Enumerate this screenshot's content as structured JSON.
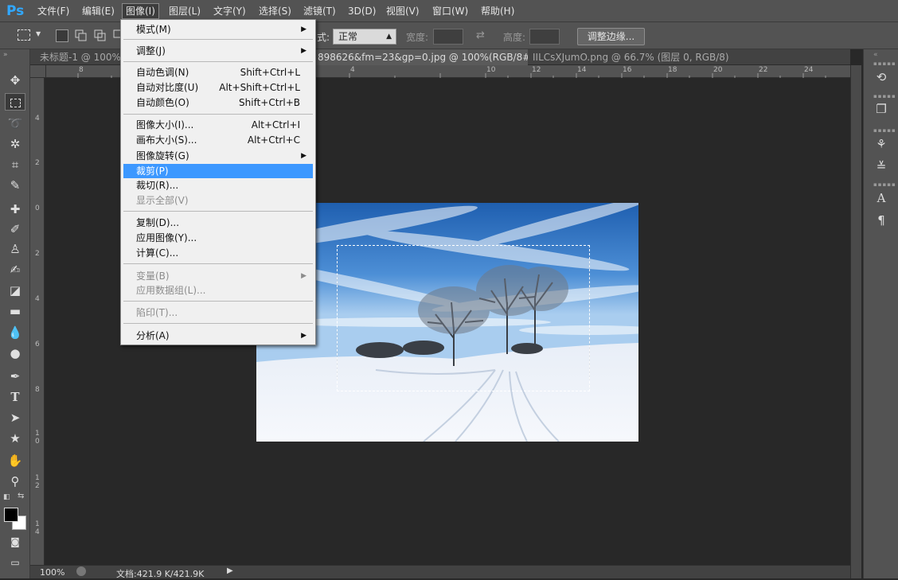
{
  "app": {
    "logo": "Ps"
  },
  "menubar": {
    "items": [
      "文件(F)",
      "编辑(E)",
      "图像(I)",
      "图层(L)",
      "文字(Y)",
      "选择(S)",
      "滤镜(T)",
      "3D(D)",
      "视图(V)",
      "窗口(W)",
      "帮助(H)"
    ],
    "open_index": 2
  },
  "options_bar": {
    "style_label": "式:",
    "style_value": "正常",
    "width_label": "宽度:",
    "height_label": "高度:",
    "refine_edge_button": "调整边缘..."
  },
  "tabs": [
    {
      "label": "未标题-1 @ 100%",
      "active": false
    },
    {
      "label": "898626&fm=23&gp=0.jpg @ 100%(RGB/8#)",
      "active": true
    },
    {
      "label": "IILCsXJumO.png @ 66.7% (图层 0, RGB/8)",
      "active": false
    }
  ],
  "tab_close_glyph": "×",
  "ruler_h": [
    "8",
    "4",
    "10",
    "12",
    "14",
    "16",
    "18",
    "20",
    "22",
    "24"
  ],
  "ruler_v": [
    "4",
    "2",
    "0",
    "2",
    "4",
    "6",
    "8",
    "1 0",
    "1 2",
    "1 4"
  ],
  "status": {
    "zoom": "100%",
    "doc_size": "文档:421.9 K/421.9K"
  },
  "image_menu": {
    "items": [
      {
        "label": "模式(M)",
        "shortcut": "",
        "submenu": true,
        "disabled": false,
        "highlight": false
      },
      {
        "label": "调整(J)",
        "shortcut": "",
        "submenu": true,
        "disabled": false,
        "highlight": false
      },
      {
        "label": "自动色调(N)",
        "shortcut": "Shift+Ctrl+L",
        "submenu": false,
        "disabled": false,
        "highlight": false
      },
      {
        "label": "自动对比度(U)",
        "shortcut": "Alt+Shift+Ctrl+L",
        "submenu": false,
        "disabled": false,
        "highlight": false
      },
      {
        "label": "自动颜色(O)",
        "shortcut": "Shift+Ctrl+B",
        "submenu": false,
        "disabled": false,
        "highlight": false
      },
      {
        "label": "图像大小(I)...",
        "shortcut": "Alt+Ctrl+I",
        "submenu": false,
        "disabled": false,
        "highlight": false
      },
      {
        "label": "画布大小(S)...",
        "shortcut": "Alt+Ctrl+C",
        "submenu": false,
        "disabled": false,
        "highlight": false
      },
      {
        "label": "图像旋转(G)",
        "shortcut": "",
        "submenu": true,
        "disabled": false,
        "highlight": false
      },
      {
        "label": "裁剪(P)",
        "shortcut": "",
        "submenu": false,
        "disabled": false,
        "highlight": true
      },
      {
        "label": "裁切(R)...",
        "shortcut": "",
        "submenu": false,
        "disabled": false,
        "highlight": false
      },
      {
        "label": "显示全部(V)",
        "shortcut": "",
        "submenu": false,
        "disabled": true,
        "highlight": false
      },
      {
        "label": "复制(D)...",
        "shortcut": "",
        "submenu": false,
        "disabled": false,
        "highlight": false
      },
      {
        "label": "应用图像(Y)...",
        "shortcut": "",
        "submenu": false,
        "disabled": false,
        "highlight": false
      },
      {
        "label": "计算(C)...",
        "shortcut": "",
        "submenu": false,
        "disabled": false,
        "highlight": false
      },
      {
        "label": "变量(B)",
        "shortcut": "",
        "submenu": true,
        "disabled": true,
        "highlight": false
      },
      {
        "label": "应用数据组(L)...",
        "shortcut": "",
        "submenu": false,
        "disabled": true,
        "highlight": false
      },
      {
        "label": "陷印(T)...",
        "shortcut": "",
        "submenu": false,
        "disabled": true,
        "highlight": false
      },
      {
        "label": "分析(A)",
        "shortcut": "",
        "submenu": true,
        "disabled": false,
        "highlight": false
      }
    ],
    "submenu_glyph": "▶"
  },
  "colors": {
    "menu_highlight": "#3c98ff",
    "ps_logo": "#31a8ff",
    "foreground": "#000000",
    "background": "#ffffff"
  }
}
